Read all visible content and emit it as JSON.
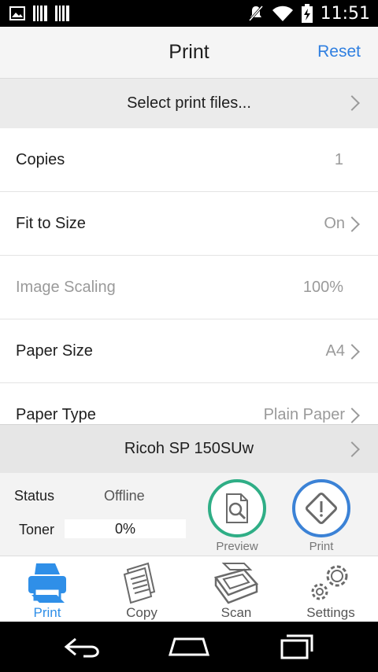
{
  "status_bar": {
    "time": "11:51",
    "left_icons": [
      "image-notification-icon",
      "barcode-notification-icon",
      "barcode-notification-icon"
    ],
    "right_icons": [
      "mute-icon",
      "wifi-icon",
      "battery-charging-icon"
    ]
  },
  "header": {
    "title": "Print",
    "reset_label": "Reset"
  },
  "select_files": {
    "label": "Select print files..."
  },
  "settings": [
    {
      "label": "Copies",
      "value": "1",
      "chevron": false,
      "disabled": false
    },
    {
      "label": "Fit to Size",
      "value": "On",
      "chevron": true,
      "disabled": false
    },
    {
      "label": "Image Scaling",
      "value": "100%",
      "chevron": false,
      "disabled": true
    },
    {
      "label": "Paper Size",
      "value": "A4",
      "chevron": true,
      "disabled": false
    },
    {
      "label": "Paper Type",
      "value": "Plain Paper",
      "chevron": true,
      "disabled": false
    }
  ],
  "printer": {
    "name": "Ricoh SP 150SUw"
  },
  "status_panel": {
    "status_label": "Status",
    "status_value": "Offline",
    "toner_label": "Toner",
    "toner_value": "0%",
    "toner_level": 0
  },
  "actions": {
    "preview_label": "Preview",
    "print_label": "Print"
  },
  "tabs": [
    {
      "label": "Print",
      "active": true
    },
    {
      "label": "Copy",
      "active": false
    },
    {
      "label": "Scan",
      "active": false
    },
    {
      "label": "Settings",
      "active": false
    }
  ],
  "colors": {
    "accent_blue": "#2f8fe8",
    "preview_ring": "#2fae86",
    "print_ring": "#3b82d6",
    "toner_fill": "#4caf50"
  }
}
